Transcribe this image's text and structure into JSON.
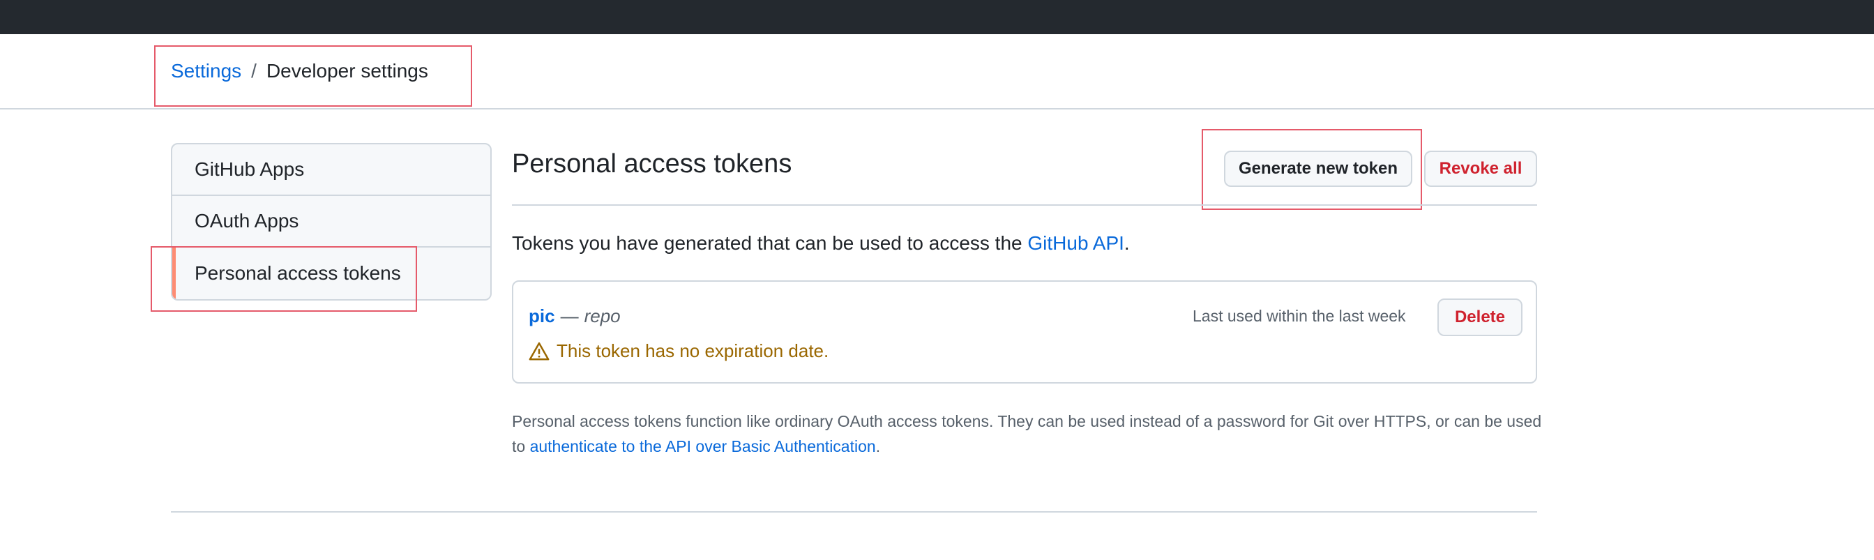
{
  "breadcrumb": {
    "settings": "Settings",
    "separator": "/",
    "current": "Developer settings"
  },
  "sidebar": {
    "items": [
      {
        "label": "GitHub Apps"
      },
      {
        "label": "OAuth Apps"
      },
      {
        "label": "Personal access tokens",
        "active": true
      }
    ]
  },
  "main": {
    "title": "Personal access tokens",
    "generate_label": "Generate new token",
    "revoke_label": "Revoke all",
    "intro_text": "Tokens you have generated that can be used to access the ",
    "intro_link": "GitHub API",
    "intro_end": "."
  },
  "token": {
    "name": "pic",
    "dash": "—",
    "scope": "repo",
    "last_used": "Last used within the last week",
    "delete_label": "Delete",
    "warning_icon": "alert-triangle-icon",
    "warning": "This token has no expiration date."
  },
  "note": {
    "text1": "Personal access tokens function like ordinary OAuth access tokens. They can be used instead of a password for Git over HTTPS, or can be used to ",
    "link": "authenticate to the API over Basic Authentication",
    "end": "."
  },
  "colors": {
    "link": "#0969da",
    "danger": "#cf222e",
    "warning": "#9a6700",
    "active_indicator": "#fd8c73",
    "topbar": "#24292f"
  }
}
